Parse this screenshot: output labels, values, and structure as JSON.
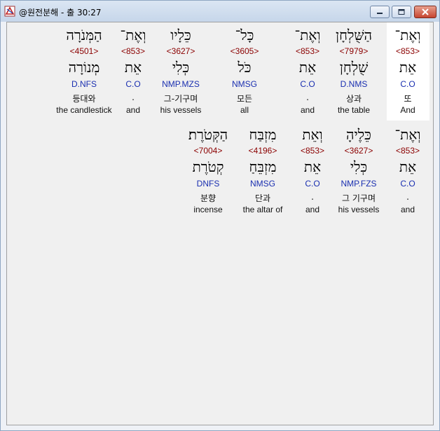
{
  "window": {
    "title": "@원전분해 - 출 30:27"
  },
  "rows": [
    {
      "words": [
        {
          "hebrew": "וְאֶת־",
          "strong": "<853>",
          "lemma": "אֵת",
          "morph": "C.O",
          "korean": "또",
          "english": "And"
        },
        {
          "hebrew": "הַשֻּׁלְחָן",
          "strong": "<7979>",
          "lemma": "שֻׁלְחָן",
          "morph": "D.NMS",
          "korean": "상과",
          "english": "the table"
        },
        {
          "hebrew": "וְאֶת־",
          "strong": "<853>",
          "lemma": "אֵת",
          "morph": "C.O",
          "korean": ".",
          "english": "and"
        },
        {
          "hebrew": "כָּל־",
          "strong": "<3605>",
          "lemma": "כֹּל",
          "morph": "NMSG",
          "korean": "모든",
          "english": "all"
        },
        {
          "hebrew": "כֵּלָיו",
          "strong": "<3627>",
          "lemma": "כְּלִי",
          "morph": "NMP.MZS",
          "korean": "그-기구며",
          "english": "his vessels"
        },
        {
          "hebrew": "וְאֶת־",
          "strong": "<853>",
          "lemma": "אֵת",
          "morph": "C.O",
          "korean": ".",
          "english": "and"
        },
        {
          "hebrew": "הַמְּנֹרָה",
          "strong": "<4501>",
          "lemma": "מְנוֹרָה",
          "morph": "D.NFS",
          "korean": "등대와",
          "english": "the candlestick"
        }
      ]
    },
    {
      "words": [
        {
          "hebrew": "וְאֶת־",
          "strong": "<853>",
          "lemma": "אֵת",
          "morph": "C.O",
          "korean": ".",
          "english": "and"
        },
        {
          "hebrew": "כֵּלֶיהָ",
          "strong": "<3627>",
          "lemma": "כְּלִי",
          "morph": "NMP.FZS",
          "korean": "그 기구며",
          "english": "his vessels"
        },
        {
          "hebrew": "וְאֵת",
          "strong": "<853>",
          "lemma": "אֵת",
          "morph": "C.O",
          "korean": ".",
          "english": "and"
        },
        {
          "hebrew": "מִזְבַּח",
          "strong": "<4196>",
          "lemma": "מִזְבֵּחַ",
          "morph": "NMSG",
          "korean": "단과",
          "english": "the altar of"
        },
        {
          "hebrew": "הַקְּטֹרֶת׃",
          "strong": "<7004>",
          "lemma": "קְטֹרֶת",
          "morph": "DNFS",
          "korean": "분향",
          "english": "incense"
        }
      ]
    }
  ]
}
